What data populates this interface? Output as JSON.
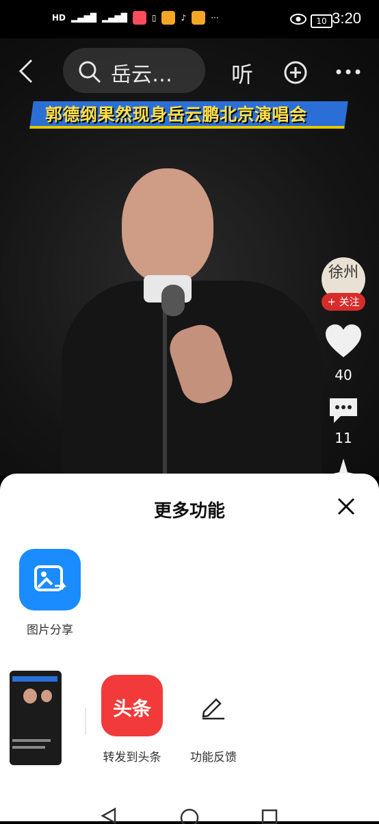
{
  "status_bar": {
    "time": "3:20",
    "left_icons": [
      "hd-icon",
      "signal-4g-icon",
      "signal-4g-icon",
      "app-icon",
      "phone-icon",
      "weibo-icon",
      "tiktok-icon",
      "weibo-icon",
      "more-dots"
    ],
    "battery": "10"
  },
  "video": {
    "search_text": "岳云…",
    "listen_label": "听",
    "banner_text": "郭德纲果然现身岳云鹏北京演唱会",
    "channel_avatar_text": "徐州",
    "follow_label": "+ 关注",
    "likes": "40",
    "comments": "11"
  },
  "sheet": {
    "title": "更多功能",
    "image_share_label": "图片分享",
    "toutiao_tile_text": "头条",
    "forward_label": "转发到头条",
    "feedback_label": "功能反馈"
  },
  "colors": {
    "accent_blue": "#1a8cff",
    "toutiao_red": "#f23a3a",
    "follow_red": "#d62c2c",
    "banner_yellow": "#ffe14a"
  }
}
